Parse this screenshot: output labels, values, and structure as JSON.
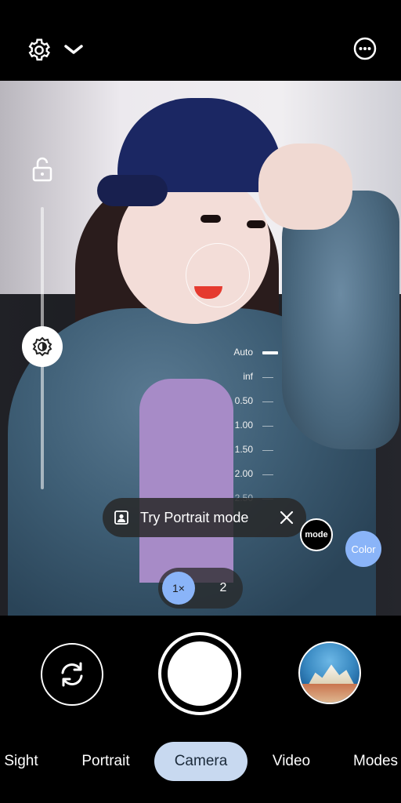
{
  "top_bar": {
    "settings_icon": "gear-icon",
    "expand_icon": "chevron-down-icon",
    "more_icon": "more-options-icon"
  },
  "focus_scale": [
    "Auto",
    "inf",
    "0.50",
    "1.00",
    "1.50",
    "2.00",
    "2.50"
  ],
  "focus_scale_selected": "Auto",
  "hint": {
    "text": "Try Portrait mode",
    "icon": "portrait-icon",
    "close_icon": "close-icon"
  },
  "mode_button": "mode",
  "color_button": "Color",
  "zoom": {
    "option_1": "1×",
    "option_2": "2"
  },
  "tabs": [
    "Sight",
    "Portrait",
    "Camera",
    "Video",
    "Modes"
  ],
  "active_tab": "Camera",
  "colors": {
    "accent": "#8ab4f8",
    "active_tab_bg": "#c8d9f0"
  }
}
